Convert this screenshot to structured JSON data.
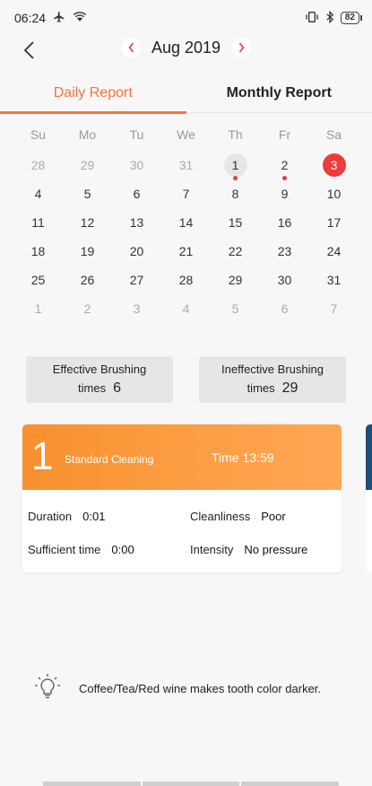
{
  "status_bar": {
    "time": "06:24",
    "battery": "82"
  },
  "header": {
    "month": "Aug 2019"
  },
  "tabs": [
    {
      "label": "Daily Report",
      "active": true
    },
    {
      "label": "Monthly Report",
      "active": false
    }
  ],
  "calendar": {
    "weekdays": [
      "Su",
      "Mo",
      "Tu",
      "We",
      "Th",
      "Fr",
      "Sa"
    ],
    "weeks": [
      [
        "28",
        "29",
        "30",
        "31",
        "1",
        "2",
        "3"
      ],
      [
        "4",
        "5",
        "6",
        "7",
        "8",
        "9",
        "10"
      ],
      [
        "11",
        "12",
        "13",
        "14",
        "15",
        "16",
        "17"
      ],
      [
        "18",
        "19",
        "20",
        "21",
        "22",
        "23",
        "24"
      ],
      [
        "25",
        "26",
        "27",
        "28",
        "29",
        "30",
        "31"
      ],
      [
        "1",
        "2",
        "3",
        "4",
        "5",
        "6",
        "7"
      ]
    ]
  },
  "stats": {
    "effective": {
      "label": "Effective Brushing",
      "unit": "times",
      "value": "6"
    },
    "ineffective": {
      "label": "Ineffective Brushing",
      "unit": "times",
      "value": "29"
    }
  },
  "session_card": {
    "index": "1",
    "mode": "Standard Cleaning",
    "time": "Time 13:59",
    "duration_label": "Duration",
    "duration": "0:01",
    "cleanliness_label": "Cleanliness",
    "cleanliness": "Poor",
    "sufficient_label": "Sufficient time",
    "sufficient": "0:00",
    "intensity_label": "Intensity",
    "intensity": "No pressure"
  },
  "tip": {
    "text": "Coffee/Tea/Red wine makes tooth color darker."
  },
  "colors": {
    "accent": "#f4753e",
    "selected": "#ee3b3b",
    "card_header": "#f8912f"
  }
}
